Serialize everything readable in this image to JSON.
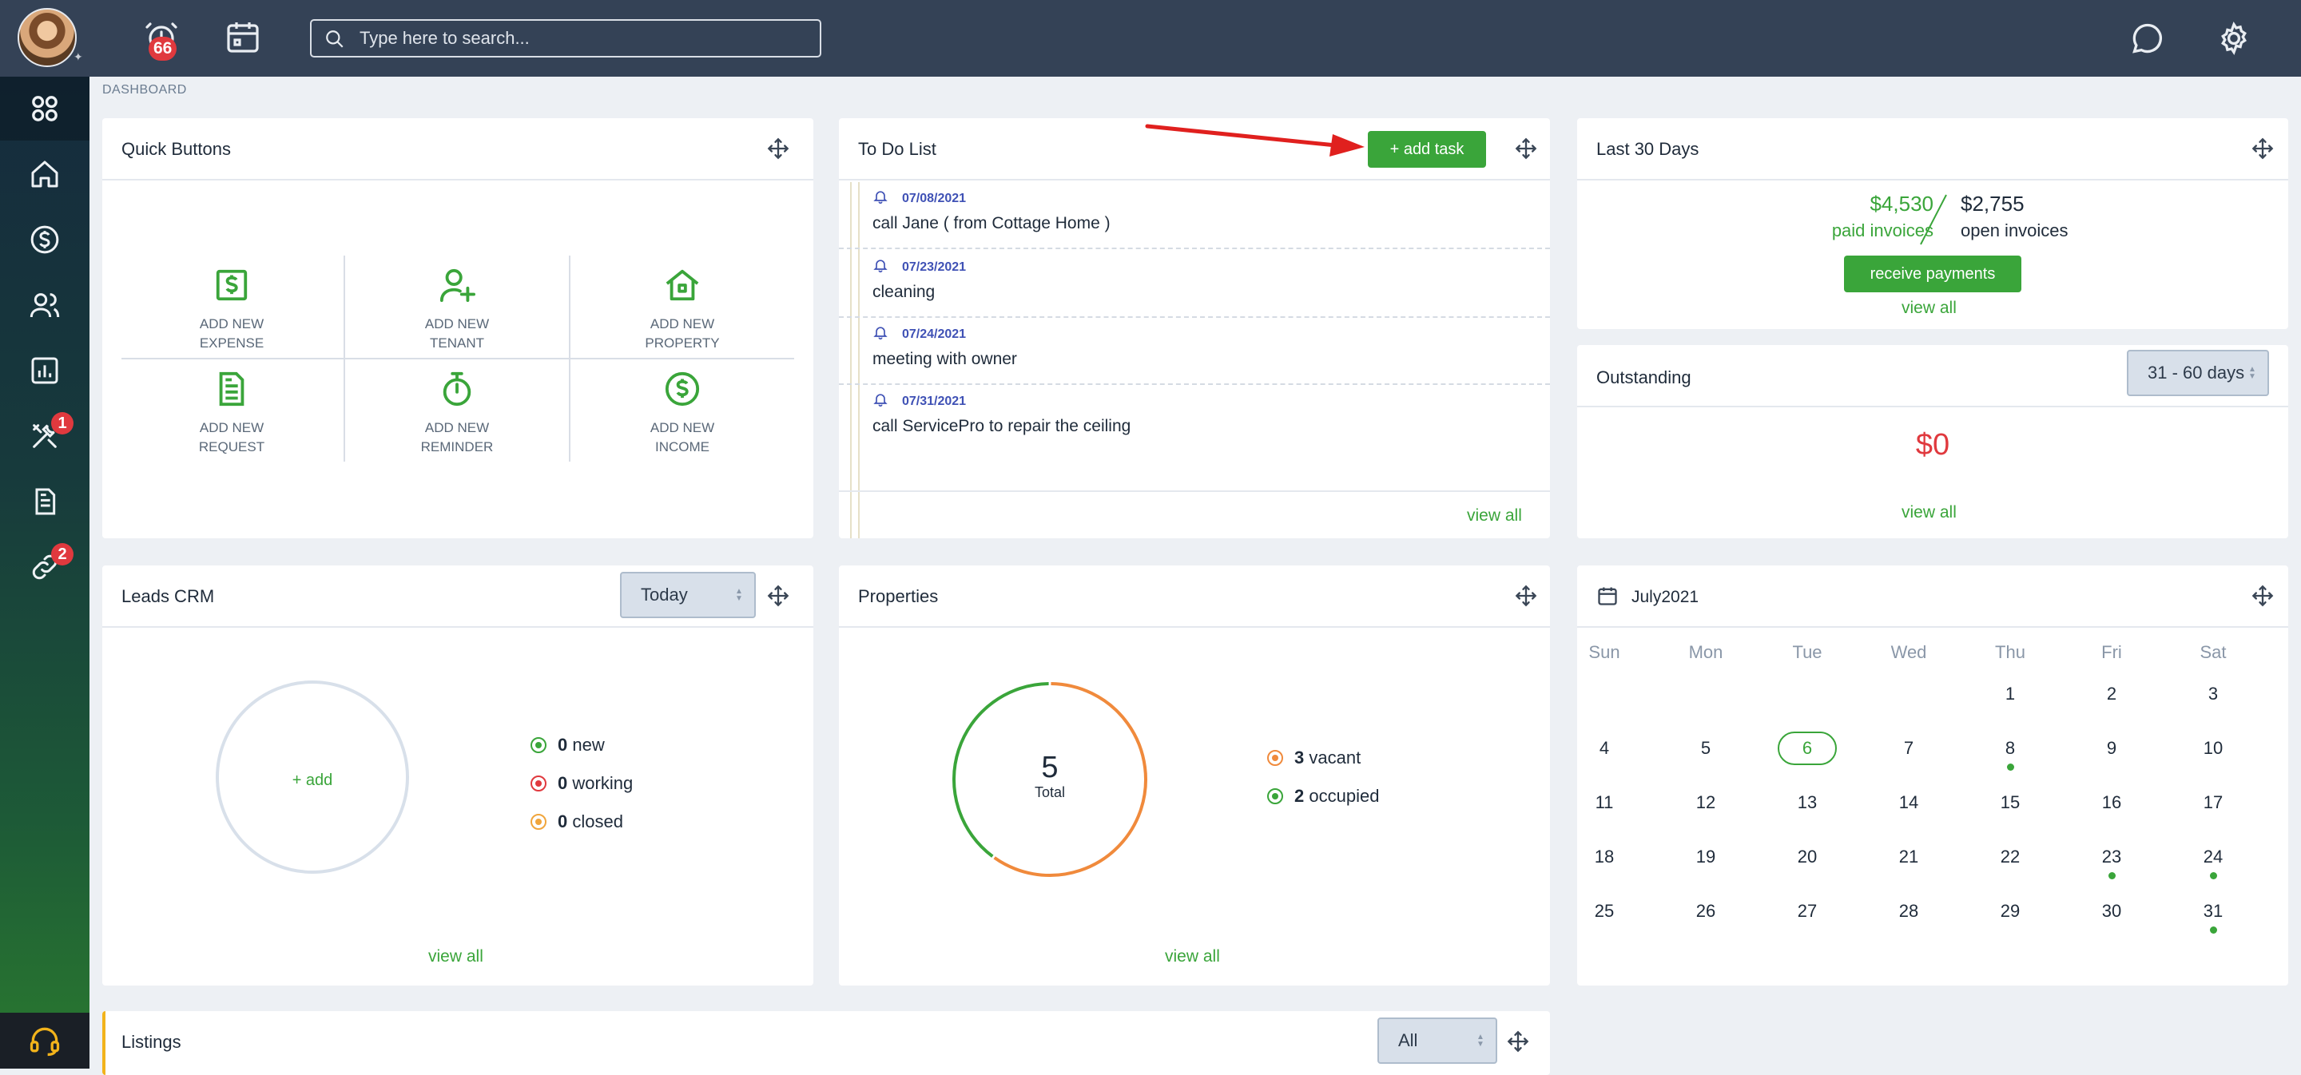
{
  "topbar": {
    "alerts_badge": "66",
    "search_placeholder": "Type here to search..."
  },
  "sidebar": {
    "items": [
      {
        "name": "dashboard",
        "icon": "grid-icon"
      },
      {
        "name": "home",
        "icon": "home-icon"
      },
      {
        "name": "money",
        "icon": "dollar-icon"
      },
      {
        "name": "people",
        "icon": "users-icon"
      },
      {
        "name": "reports",
        "icon": "chart-icon"
      },
      {
        "name": "maintenance",
        "icon": "tools-icon",
        "badge": "1"
      },
      {
        "name": "documents",
        "icon": "document-icon"
      },
      {
        "name": "links",
        "icon": "link-icon",
        "badge": "2"
      }
    ],
    "support_icon": "headset-icon"
  },
  "breadcrumb": "DASHBOARD",
  "quick_buttons": {
    "title": "Quick Buttons",
    "items": [
      {
        "line1": "ADD NEW",
        "line2": "EXPENSE",
        "icon": "dollar-doc-icon"
      },
      {
        "line1": "ADD NEW",
        "line2": "TENANT",
        "icon": "user-plus-icon"
      },
      {
        "line1": "ADD NEW",
        "line2": "PROPERTY",
        "icon": "house-icon"
      },
      {
        "line1": "ADD NEW",
        "line2": "REQUEST",
        "icon": "document-icon"
      },
      {
        "line1": "ADD NEW",
        "line2": "REMINDER",
        "icon": "stopwatch-icon"
      },
      {
        "line1": "ADD NEW",
        "line2": "INCOME",
        "icon": "dollar-circle-icon"
      }
    ]
  },
  "todo": {
    "title": "To Do List",
    "add_label": "+ add task",
    "items": [
      {
        "date": "07/08/2021",
        "text": "call Jane ( from Cottage Home )"
      },
      {
        "date": "07/23/2021",
        "text": "cleaning"
      },
      {
        "date": "07/24/2021",
        "text": "meeting with owner"
      },
      {
        "date": "07/31/2021",
        "text": "call ServicePro to repair the ceiling"
      }
    ],
    "view_all": "view all"
  },
  "last30": {
    "title": "Last 30 Days",
    "paid_amount": "$4,530",
    "paid_label": "paid invoices",
    "open_amount": "$2,755",
    "open_label": "open invoices",
    "button": "receive payments",
    "view_all": "view all"
  },
  "outstanding": {
    "title": "Outstanding",
    "select": "31 - 60 days",
    "amount": "$0",
    "view_all": "view all"
  },
  "leads": {
    "title": "Leads CRM",
    "select": "Today",
    "add": "+ add",
    "legend": [
      {
        "count": "0",
        "label": "new",
        "color": "#3aa53a"
      },
      {
        "count": "0",
        "label": "working",
        "color": "#e0393e"
      },
      {
        "count": "0",
        "label": "closed",
        "color": "#f0a53c"
      }
    ],
    "view_all": "view all"
  },
  "properties": {
    "title": "Properties",
    "total": "5",
    "total_label": "Total",
    "legend": [
      {
        "count": "3",
        "label": "vacant",
        "color": "#f08a3c"
      },
      {
        "count": "2",
        "label": "occupied",
        "color": "#3aa53a"
      }
    ],
    "view_all": "view all"
  },
  "calendar": {
    "title": "July2021",
    "dow": [
      "Sun",
      "Mon",
      "Tue",
      "Wed",
      "Thu",
      "Fri",
      "Sat"
    ],
    "first_weekday": 4,
    "days": 31,
    "today": 6,
    "dots": [
      8,
      23,
      24,
      31
    ]
  },
  "listings": {
    "title": "Listings",
    "select": "All"
  },
  "colors": {
    "accent": "#3aa53a",
    "danger": "#e0393e",
    "topbar": "#344256"
  }
}
